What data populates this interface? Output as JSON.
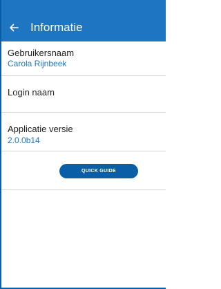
{
  "header": {
    "title": "Informatie",
    "back_icon": "arrow-left-icon"
  },
  "info": {
    "username_label": "Gebruikersnaam",
    "username_value": "Carola Rijnbeek",
    "login_label": "Login naam",
    "login_value": "",
    "version_label": "Applicatie versie",
    "version_value": "2.0.0b14"
  },
  "actions": {
    "quick_guide_label": "QUICK GUIDE"
  },
  "colors": {
    "primary": "#1e76c3",
    "button": "#0a5ea8",
    "divider": "#d9d9d9"
  }
}
